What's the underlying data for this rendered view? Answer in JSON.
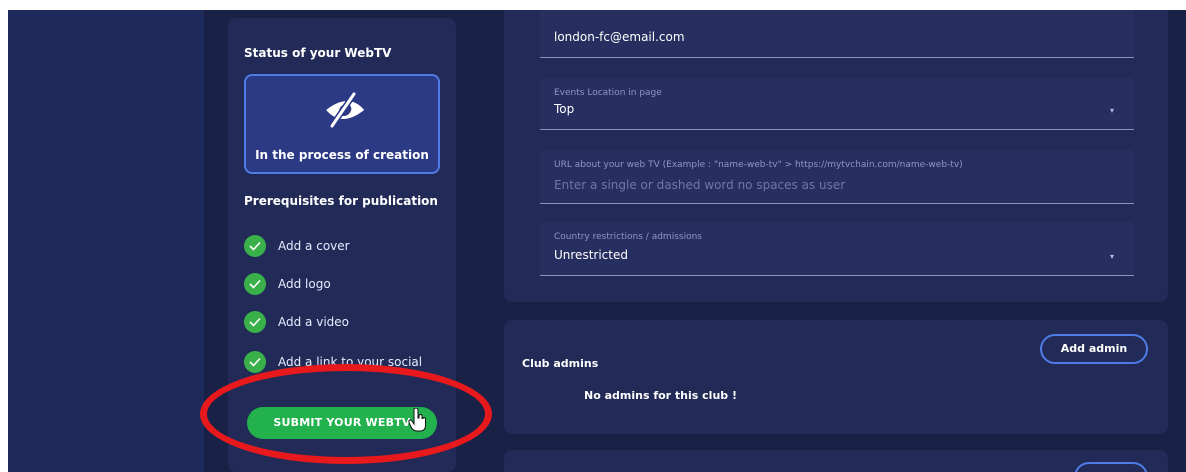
{
  "status": {
    "title": "Status of your WebTV",
    "state_label": "In the process of creation",
    "state_icon": "eye-slash-icon"
  },
  "prerequisites": {
    "title": "Prerequisites for publication",
    "items": [
      {
        "label": "Add a cover",
        "done": true
      },
      {
        "label": "Add logo",
        "done": true
      },
      {
        "label": "Add a video",
        "done": true
      },
      {
        "label": "Add a link to your social",
        "done": true
      }
    ],
    "submit_label": "SUBMIT YOUR WEBTV"
  },
  "form": {
    "email": {
      "value": "london-fc@email.com"
    },
    "events_location": {
      "label": "Events Location in page",
      "value": "Top"
    },
    "url": {
      "label": "URL about your web TV (Example : \"name-web-tv\" > https://mytvchain.com/name-web-tv)",
      "placeholder": "Enter a single or dashed word no spaces as user"
    },
    "country": {
      "label": "Country restrictions / admissions",
      "value": "Unrestricted"
    },
    "dropdown_glyph": "▾"
  },
  "admins": {
    "title": "Club admins",
    "add_label": "Add admin",
    "empty_text": "No admins for this club !"
  },
  "colors": {
    "background": "#1a2147",
    "card": "#222b57",
    "accent_blue": "#4f7be6",
    "success_green": "#22b14c",
    "highlight_red": "#e8191c"
  }
}
